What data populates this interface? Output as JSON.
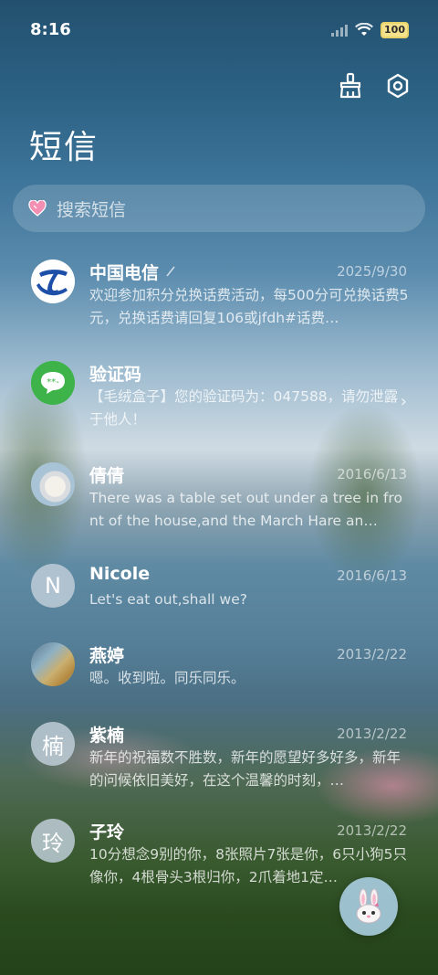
{
  "status_bar": {
    "time": "8:16",
    "battery": "100"
  },
  "header": {
    "title": "短信",
    "actions": [
      {
        "icon": "broom-icon"
      },
      {
        "icon": "settings-icon"
      }
    ]
  },
  "search": {
    "placeholder": "搜索短信",
    "icon": "heart-icon"
  },
  "conversations": [
    {
      "name": "中国电信",
      "date": "2025/9/30",
      "preview": "欢迎参加积分兑换话费活动，每500分可兑换话费5元，兑换话费请回复106或jfdh#话费…",
      "avatar": "china-telecom-logo",
      "pinned_edit": true
    },
    {
      "name": "验证码",
      "date": "",
      "preview": "【毛绒盒子】您的验证码为：047588，请勿泄露于他人！",
      "avatar": "message-bubble-icon"
    },
    {
      "name": "倩倩",
      "date": "2016/6/13",
      "preview": "There was a table set out under a tree in front of the house,and the March Hare an…",
      "avatar": "polar-bear-photo"
    },
    {
      "name": "Nicole",
      "date": "2016/6/13",
      "preview": "Let's eat out,shall we?",
      "avatar_letter": "N"
    },
    {
      "name": "燕婷",
      "date": "2013/2/22",
      "preview": "嗯。收到啦。同乐同乐。",
      "avatar": "landscape-photo"
    },
    {
      "name": "紫楠",
      "date": "2013/2/22",
      "preview": "新年的祝福数不胜数，新年的愿望好多好多，新年的问候依旧美好，在这个温馨的时刻，…",
      "avatar_letter": "楠"
    },
    {
      "name": "子玲",
      "date": "2013/2/22",
      "preview": "10分想念9别的你，8张照片7张是你，6只小狗5只像你，4根骨头3根归你，2爪着地1定…",
      "avatar_letter": "玲"
    }
  ],
  "fab": {
    "icon": "bunny-compose-icon"
  },
  "colors": {
    "telecom_blue": "#1d4fa8",
    "sms_green": "#3db34a"
  }
}
